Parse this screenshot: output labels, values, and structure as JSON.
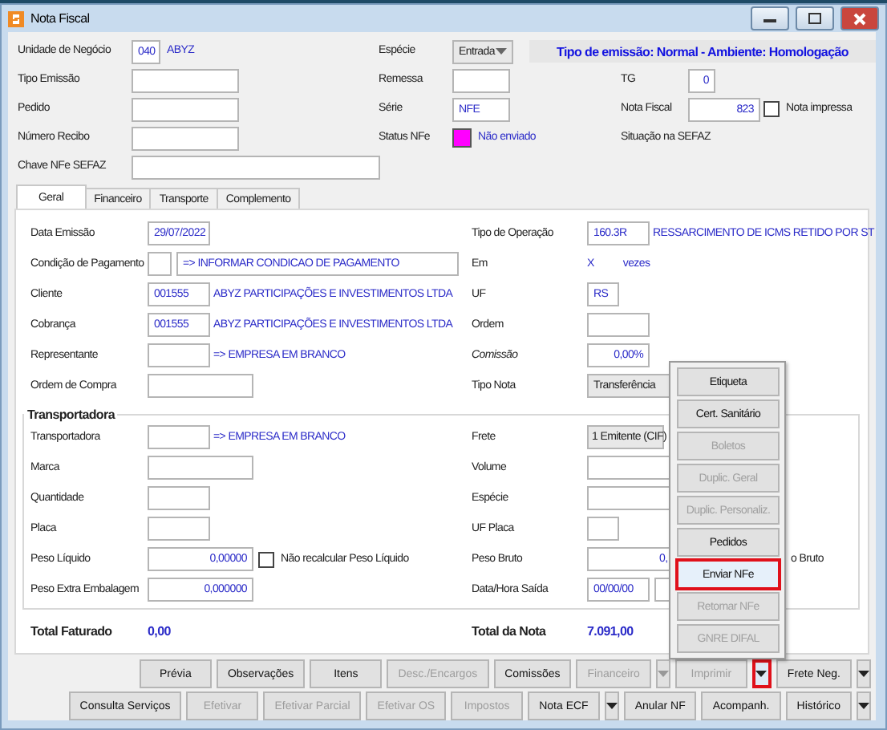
{
  "window": {
    "title": "Nota Fiscal"
  },
  "emission_info": "Tipo de emissão: Normal - Ambiente: Homologação",
  "header": {
    "unidade": {
      "label": "Unidade de Negócio",
      "code": "040",
      "name": "ABYZ"
    },
    "tipo_emissao": {
      "label": "Tipo Emissão"
    },
    "pedido": {
      "label": "Pedido"
    },
    "numero_recibo": {
      "label": "Número Recibo"
    },
    "chave": {
      "label": "Chave NFe SEFAZ"
    },
    "especie": {
      "label": "Espécie",
      "value": "Entrada"
    },
    "remessa": {
      "label": "Remessa"
    },
    "serie": {
      "label": "Série",
      "value": "NFE"
    },
    "status": {
      "label": "Status NFe",
      "text": "Não enviado",
      "color": "#ff00ff"
    },
    "tg": {
      "label": "TG",
      "value": "0"
    },
    "nota_fiscal": {
      "label": "Nota Fiscal",
      "value": "823",
      "checkbox": {
        "label": "Nota impressa",
        "checked": false
      }
    },
    "situacao": {
      "label": "Situação na SEFAZ"
    }
  },
  "tabs": [
    {
      "label": "Geral",
      "selected": true
    },
    {
      "label": "Financeiro",
      "selected": false
    },
    {
      "label": "Transporte",
      "selected": false
    },
    {
      "label": "Complemento",
      "selected": false
    }
  ],
  "geral": {
    "data_emissao": {
      "label": "Data Emissão",
      "value": "29/07/2022"
    },
    "condicao": {
      "label": "Condição de Pagamento",
      "description": "=> INFORMAR CONDICAO DE PAGAMENTO"
    },
    "cliente": {
      "label": "Cliente",
      "code": "001555",
      "description": "ABYZ PARTICIPAÇÕES E INVESTIMENTOS LTDA"
    },
    "cobranca": {
      "label": "Cobrança",
      "code": "001555",
      "description": "ABYZ PARTICIPAÇÕES E INVESTIMENTOS LTDA"
    },
    "representante": {
      "label": "Representante",
      "description": "=> EMPRESA EM BRANCO"
    },
    "ordem_compra": {
      "label": "Ordem de Compra"
    },
    "tipo_operacao": {
      "label": "Tipo de Operação",
      "code": "160.3R",
      "description": "RESSARCIMENTO DE ICMS RETIDO POR ST"
    },
    "em": {
      "label": "Em",
      "value": "X",
      "suffix": "vezes"
    },
    "uf": {
      "label": "UF",
      "value": "RS"
    },
    "ordem": {
      "label": "Ordem"
    },
    "comissao": {
      "label": "Comissão",
      "value": "0,00%"
    },
    "tipo_nota": {
      "label": "Tipo Nota",
      "value": "Transferência"
    }
  },
  "transportadora": {
    "title": "Transportadora",
    "transportadora": {
      "label": "Transportadora",
      "description": "=> EMPRESA EM BRANCO"
    },
    "marca": {
      "label": "Marca"
    },
    "quantidade": {
      "label": "Quantidade"
    },
    "placa": {
      "label": "Placa"
    },
    "peso_liquido": {
      "label": "Peso Líquido",
      "value": "0,00000",
      "checkbox": {
        "label": "Não recalcular Peso Líquido",
        "checked": false
      }
    },
    "peso_extra": {
      "label": "Peso Extra Embalagem",
      "value": "0,000000"
    },
    "frete": {
      "label": "Frete",
      "value": "1 Emitente (CIF)"
    },
    "volume": {
      "label": "Volume"
    },
    "especie": {
      "label": "Espécie"
    },
    "uf_placa": {
      "label": "UF Placa"
    },
    "peso_bruto": {
      "label": "Peso Bruto",
      "value": "0,",
      "checkbox_label": "o Bruto"
    },
    "data_hora_saida": {
      "label": "Data/Hora Saída",
      "value": "00/00/00"
    }
  },
  "totals": {
    "faturado": {
      "label": "Total Faturado",
      "value": "0,00"
    },
    "nota": {
      "label": "Total da Nota",
      "value": "7.091,00"
    }
  },
  "button_rows": [
    [
      {
        "kind": "button",
        "label": "Prévia",
        "disabled": false
      },
      {
        "kind": "button",
        "label": "Observações",
        "disabled": false
      },
      {
        "kind": "button",
        "label": "Itens",
        "disabled": false
      },
      {
        "kind": "button",
        "label": "Desc./Encargos",
        "disabled": true
      },
      {
        "kind": "button",
        "label": "Comissões",
        "disabled": false
      },
      {
        "kind": "split",
        "label": "Financeiro",
        "disabled": true
      },
      {
        "kind": "button",
        "label": "Imprimir",
        "disabled": true
      },
      {
        "kind": "arrow",
        "highlighted": true
      },
      {
        "kind": "split",
        "label": "Frete Neg.",
        "disabled": false
      }
    ],
    [
      {
        "kind": "button",
        "label": "Consulta Serviços",
        "disabled": false
      },
      {
        "kind": "button",
        "label": "Efetivar",
        "disabled": true
      },
      {
        "kind": "button",
        "label": "Efetivar Parcial",
        "disabled": true
      },
      {
        "kind": "button",
        "label": "Efetivar OS",
        "disabled": true
      },
      {
        "kind": "button",
        "label": "Impostos",
        "disabled": true
      },
      {
        "kind": "split",
        "label": "Nota ECF",
        "disabled": false
      },
      {
        "kind": "button",
        "label": "Anular NF",
        "disabled": false
      },
      {
        "kind": "button",
        "label": "Acompanh.",
        "disabled": false
      },
      {
        "kind": "split",
        "label": "Histórico",
        "disabled": false
      }
    ]
  ],
  "print_menu": [
    {
      "label": "Etiqueta",
      "disabled": false,
      "highlighted": false
    },
    {
      "label": "Cert. Sanitário",
      "disabled": false,
      "highlighted": false
    },
    {
      "label": "Boletos",
      "disabled": true,
      "highlighted": false
    },
    {
      "label": "Duplic. Geral",
      "disabled": true,
      "highlighted": false
    },
    {
      "label": "Duplic. Personaliz.",
      "disabled": true,
      "highlighted": false
    },
    {
      "label": "Pedidos",
      "disabled": false,
      "highlighted": false
    },
    {
      "label": "Enviar NFe",
      "disabled": false,
      "highlighted": true
    },
    {
      "label": "Retomar NFe",
      "disabled": true,
      "highlighted": false
    },
    {
      "label": "GNRE DIFAL",
      "disabled": true,
      "highlighted": false
    }
  ]
}
